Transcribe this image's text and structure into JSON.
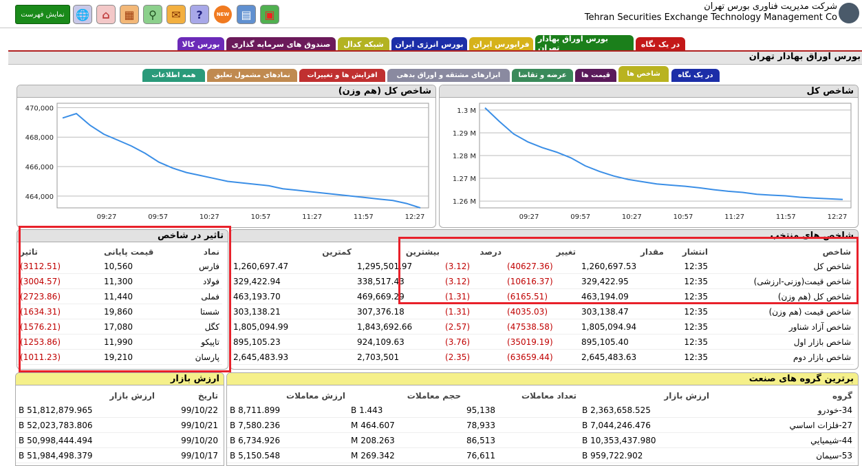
{
  "header": {
    "company_fa": "شرکت مدیریت فناوری بورس تهران",
    "company_en": "Tehran Securities Exchange Technology Management  Co",
    "show_list_label": "نمایش فهرست",
    "new_badge": "NEW"
  },
  "market_tabs": [
    {
      "label": "در یک نگاه",
      "color": "#c41818"
    },
    {
      "label": "بورس اوراق بهادار تهران",
      "color": "#1b7f1b"
    },
    {
      "label": "فرابورس ایران",
      "color": "#d6b21a"
    },
    {
      "label": "بورس انرژی ایران",
      "color": "#1c2ea8"
    },
    {
      "label": "شبکه کدال",
      "color": "#b3b322"
    },
    {
      "label": "صندوق های سرمایه گذاری",
      "color": "#6b1a5a"
    },
    {
      "label": "بورس کالا",
      "color": "#6b2ab8"
    }
  ],
  "page_title": "بورس اوراق بهادار تهران",
  "sub_tabs": [
    {
      "label": "در یک نگاه",
      "color": "#1c2ea8"
    },
    {
      "label": "شاخص ها",
      "color": "#b9b320"
    },
    {
      "label": "قیمت ها",
      "color": "#5a1a5a"
    },
    {
      "label": "عرضه و تقاضا",
      "color": "#3a8a5a"
    },
    {
      "label": "ابزارهای مشتقه و اوراق بدهی",
      "color": "#8a8aa0"
    },
    {
      "label": "افزایش ها و تغییرات",
      "color": "#c03030"
    },
    {
      "label": "نمادهای مشمول تعلیق",
      "color": "#c08a50"
    },
    {
      "label": "همه اطلاعات",
      "color": "#2a9a7a"
    }
  ],
  "chart_data": [
    {
      "type": "line",
      "title": "شاخص کل",
      "x_ticks": [
        "09:27",
        "09:57",
        "10:27",
        "10:57",
        "11:27",
        "11:57",
        "12:27"
      ],
      "y_ticks": [
        "1.26 M",
        "1.27 M",
        "1.28 M",
        "1.29 M",
        "1.3 M"
      ],
      "ylim": [
        1257000,
        1303000
      ],
      "grid": true,
      "series": [
        {
          "color": "#3a8ee6",
          "values": [
            1301000,
            1295000,
            1289500,
            1286000,
            1283500,
            1281500,
            1279000,
            1275500,
            1273000,
            1271000,
            1269500,
            1268500,
            1267500,
            1267000,
            1266500,
            1265800,
            1265000,
            1264300,
            1263800,
            1263000,
            1262600,
            1262300,
            1261700,
            1261300,
            1261000,
            1260700
          ]
        }
      ]
    },
    {
      "type": "line",
      "title": "شاخص کل (هم وزن)",
      "x_ticks": [
        "09:27",
        "09:57",
        "10:27",
        "10:57",
        "11:27",
        "11:57",
        "12:27"
      ],
      "y_ticks": [
        "464,000",
        "466,000",
        "468,000",
        "470,000"
      ],
      "ylim": [
        463200,
        470300
      ],
      "grid": true,
      "series": [
        {
          "color": "#3a8ee6",
          "values": [
            469300,
            469600,
            468800,
            468200,
            467800,
            467400,
            466900,
            466300,
            465900,
            465600,
            465400,
            465200,
            465000,
            464900,
            464800,
            464700,
            464500,
            464400,
            464300,
            464200,
            464100,
            464000,
            463900,
            463800,
            463700,
            463500,
            463200
          ]
        }
      ]
    }
  ],
  "influence": {
    "title": "تاثیر در شاخص",
    "headers": {
      "symbol": "نماد",
      "price": "قیمت پایانی",
      "effect": "تاثیر"
    },
    "rows": [
      {
        "symbol": "فارس",
        "price": "10,560",
        "effect": "(3112.51)"
      },
      {
        "symbol": "فولاد",
        "price": "11,300",
        "effect": "(3004.57)"
      },
      {
        "symbol": "فملی",
        "price": "11,440",
        "effect": "(2723.86)"
      },
      {
        "symbol": "شستا",
        "price": "19,860",
        "effect": "(1634.31)"
      },
      {
        "symbol": "کگل",
        "price": "17,080",
        "effect": "(1576.21)"
      },
      {
        "symbol": "تاپیکو",
        "price": "11,990",
        "effect": "(1253.86)"
      },
      {
        "symbol": "پارسان",
        "price": "19,210",
        "effect": "(1011.23)"
      }
    ]
  },
  "indices": {
    "title": "شاخص های منتخب",
    "headers": {
      "name": "شاخص",
      "time": "انتشار",
      "value": "مقدار",
      "change": "تغییر",
      "percent": "درصد",
      "high": "بیشترین",
      "low": "کمترین"
    },
    "rows": [
      {
        "name": "شاخص کل",
        "time": "12:35",
        "value": "1,260,697.53",
        "change": "(40627.36)",
        "percent": "(3.12)",
        "high": "1,295,501.97",
        "low": "1,260,697.47"
      },
      {
        "name": "شاخص قیمت(وزنی-ارزشی)",
        "time": "12:35",
        "value": "329,422.95",
        "change": "(10616.37)",
        "percent": "(3.12)",
        "high": "338,517.43",
        "low": "329,422.94"
      },
      {
        "name": "شاخص کل (هم وزن)",
        "time": "12:35",
        "value": "463,194.09",
        "change": "(6165.51)",
        "percent": "(1.31)",
        "high": "469,669.29",
        "low": "463,193.70"
      },
      {
        "name": "شاخص قیمت (هم وزن)",
        "time": "12:35",
        "value": "303,138.47",
        "change": "(4035.03)",
        "percent": "(1.31)",
        "high": "307,376.18",
        "low": "303,138.21"
      },
      {
        "name": "شاخص آزاد شناور",
        "time": "12:35",
        "value": "1,805,094.94",
        "change": "(47538.58)",
        "percent": "(2.57)",
        "high": "1,843,692.66",
        "low": "1,805,094.99"
      },
      {
        "name": "شاخص بازار اول",
        "time": "12:35",
        "value": "895,105.40",
        "change": "(35019.19)",
        "percent": "(3.76)",
        "high": "924,109.63",
        "low": "895,105.23"
      },
      {
        "name": "شاخص بازار دوم",
        "time": "12:35",
        "value": "2,645,483.63",
        "change": "(63659.44)",
        "percent": "(2.35)",
        "high": "2,703,501",
        "low": "2,645,483.93"
      }
    ]
  },
  "market_value": {
    "title": "ارزش بازار",
    "headers": {
      "date": "تاریخ",
      "value": "ارزش بازار"
    },
    "rows": [
      {
        "date": "99/10/22",
        "value": "51,812,879.965 B"
      },
      {
        "date": "99/10/21",
        "value": "52,023,783.806 B"
      },
      {
        "date": "99/10/20",
        "value": "50,998,444.494 B"
      },
      {
        "date": "99/10/17",
        "value": "51,984,498.379 B"
      }
    ]
  },
  "top_groups": {
    "title": "برترین گروه های صنعت",
    "headers": {
      "group": "گروه",
      "market_value": "ارزش بازار",
      "count": "تعداد معاملات",
      "volume": "حجم معاملات",
      "value": "ارزش معاملات"
    },
    "rows": [
      {
        "group": "34-خودرو",
        "market_value": "2,363,658.525 B",
        "count": "95,138",
        "volume": "1.443 B",
        "value": "8,711.899 B"
      },
      {
        "group": "27-فلزات اساسي",
        "market_value": "7,044,246.476 B",
        "count": "78,933",
        "volume": "464.607 M",
        "value": "7,580.236 B"
      },
      {
        "group": "44-شيميايي",
        "market_value": "10,353,437.980 B",
        "count": "86,513",
        "volume": "208.263 M",
        "value": "6,734.926 B"
      },
      {
        "group": "53-سيمان",
        "market_value": "959,722.902 B",
        "count": "76,611",
        "volume": "269.342 M",
        "value": "5,150.548 B"
      }
    ]
  }
}
